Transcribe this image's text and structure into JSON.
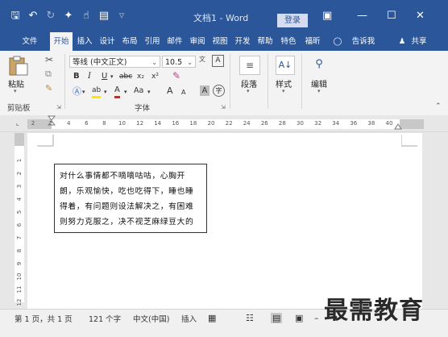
{
  "title_bar": {
    "doc_title": "文档1 - Word",
    "login_label": "登录",
    "qat_icons": [
      "save-icon",
      "undo-icon",
      "redo-icon",
      "format-painter-icon",
      "touch-mode-icon",
      "new-doc-icon",
      "customize-icon"
    ],
    "window_controls": [
      "ribbon-display-icon",
      "minimize-icon",
      "maximize-icon",
      "close-icon"
    ]
  },
  "tabs": {
    "file": "文件",
    "home": "开始",
    "insert": "插入",
    "design": "设计",
    "layout": "布局",
    "references": "引用",
    "mailings": "邮件",
    "review": "审阅",
    "view": "视图",
    "developer": "开发",
    "help": "帮助",
    "special": "特色",
    "foxit": "福昕",
    "tell_me": "告诉我",
    "share": "共享"
  },
  "ribbon": {
    "clipboard": {
      "paste_label": "粘贴",
      "group_label": "剪贴板"
    },
    "font": {
      "font_name": "等线 (中文正文)",
      "font_size": "10.5",
      "group_label": "字体",
      "bold": "B",
      "italic": "I",
      "underline": "U",
      "strike": "abc",
      "subscript": "x₂",
      "superscript": "x²",
      "font_color": "A",
      "highlight": "ab",
      "case": "Aa",
      "grow": "A",
      "shrink": "A",
      "char_shading": "A",
      "enclosed": "字"
    },
    "paragraph_label": "段落",
    "styles_label": "样式",
    "editing_label": "编辑"
  },
  "ruler": {
    "labels": [
      "2",
      "2",
      "4",
      "6",
      "8",
      "10",
      "12",
      "14",
      "16",
      "18",
      "20",
      "22",
      "24",
      "26",
      "28",
      "30",
      "32",
      "34",
      "36",
      "38",
      "40"
    ],
    "vertical_labels": [
      "1",
      "2",
      "3",
      "4",
      "5",
      "6",
      "7",
      "8",
      "9",
      "10",
      "11",
      "12"
    ]
  },
  "document": {
    "lines": [
      "对什么事情都不嘀嘀咕咕，心胸开",
      "朗，乐观愉快，吃也吃得下，睡也睡",
      "得着，有问题则设法解决之，有困难",
      "则努力克服之，决不视芝麻绿豆大的"
    ]
  },
  "status_bar": {
    "page": "第 1 页，共 1 页",
    "words": "121 个字",
    "language": "中文(中国)",
    "insert_mode": "插入"
  },
  "watermark": "最需教育",
  "colors": {
    "accent": "#2b579a"
  }
}
